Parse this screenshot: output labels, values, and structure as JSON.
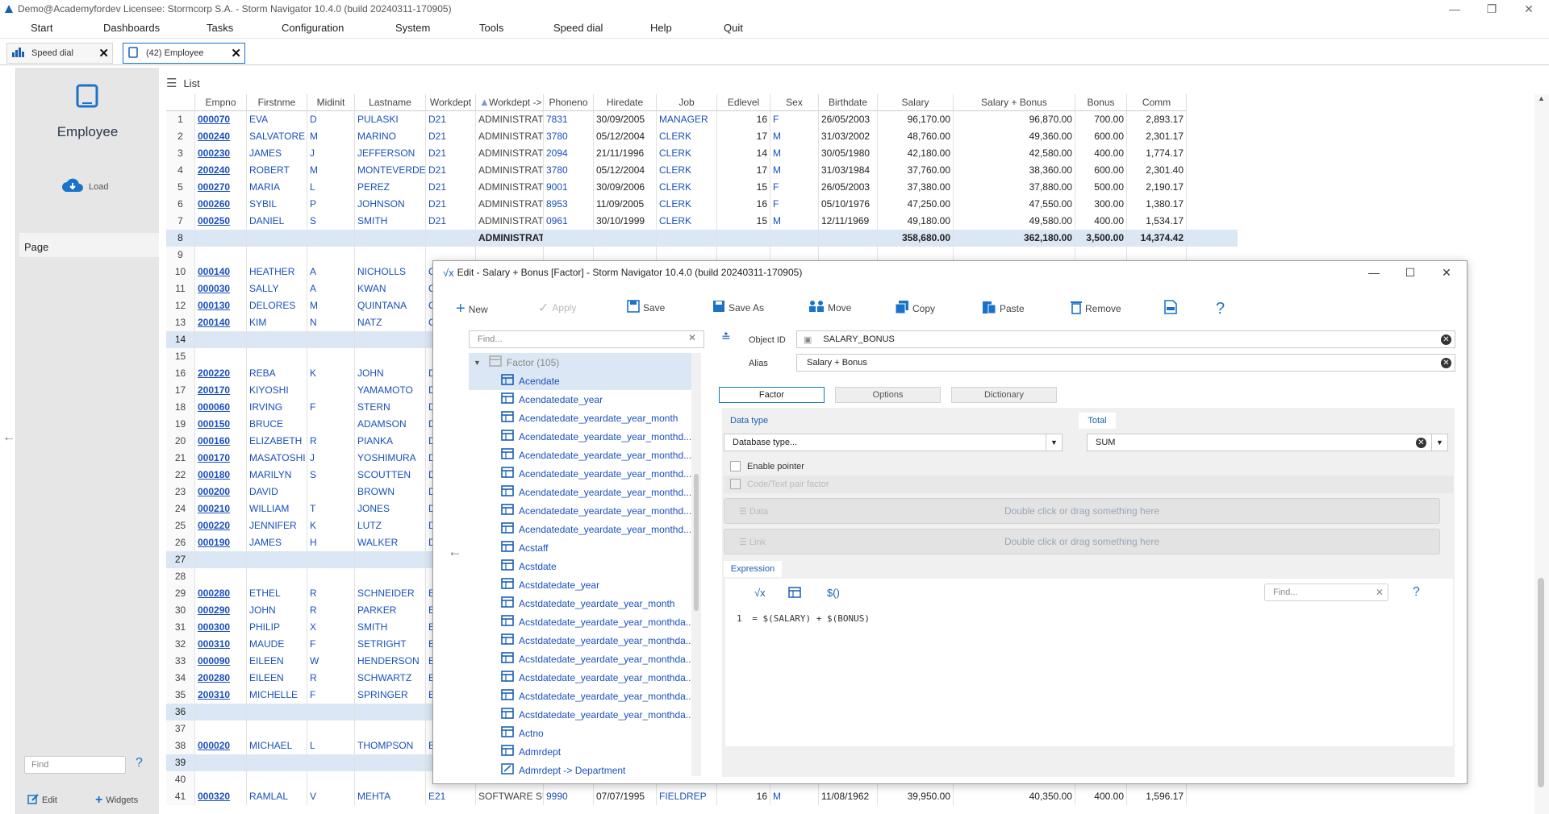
{
  "window": {
    "title": "Demo@Academyfordev    Licensee: Stormcorp S.A. - Storm Navigator 10.4.0 (build 20240311-170905)"
  },
  "menu": [
    "Start",
    "Dashboards",
    "Tasks",
    "Configuration",
    "System",
    "Tools",
    "Speed dial",
    "Help",
    "Quit"
  ],
  "tabs": [
    {
      "label": "Speed dial"
    },
    {
      "label": "(42) Employee"
    }
  ],
  "sidebar": {
    "title": "Employee",
    "load_label": "Load",
    "page_label": "Page",
    "find_placeholder": "Find",
    "edit_label": "Edit",
    "widgets_label": "Widgets"
  },
  "list": {
    "label": "List"
  },
  "grid": {
    "columns": [
      "Empno",
      "Firstnme",
      "Midinit",
      "Lastname",
      "Workdept",
      "Workdept -> Department",
      "Phoneno",
      "Hiredate",
      "Job",
      "Edlevel",
      "Sex",
      "Birthdate",
      "Salary",
      "Salary + Bonus",
      "Bonus",
      "Comm"
    ],
    "rows": [
      {
        "n": "1",
        "c": [
          "000070",
          "EVA",
          "D",
          "PULASKI",
          "D21",
          "ADMINISTRATION SYSTEMS",
          "7831",
          "30/09/2005",
          "MANAGER",
          "16",
          "F",
          "26/05/2003",
          "96,170.00",
          "96,870.00",
          "700.00",
          "2,893.17"
        ]
      },
      {
        "n": "2",
        "c": [
          "000240",
          "SALVATORE",
          "M",
          "MARINO",
          "D21",
          "ADMINISTRATION SYSTEMS",
          "3780",
          "05/12/2004",
          "CLERK",
          "17",
          "M",
          "31/03/2002",
          "48,760.00",
          "49,360.00",
          "600.00",
          "2,301.17"
        ]
      },
      {
        "n": "3",
        "c": [
          "000230",
          "JAMES",
          "J",
          "JEFFERSON",
          "D21",
          "ADMINISTRATION SYSTEMS",
          "2094",
          "21/11/1996",
          "CLERK",
          "14",
          "M",
          "30/05/1980",
          "42,180.00",
          "42,580.00",
          "400.00",
          "1,774.17"
        ]
      },
      {
        "n": "4",
        "c": [
          "200240",
          "ROBERT",
          "M",
          "MONTEVERDE",
          "D21",
          "ADMINISTRATION SYSTEMS",
          "3780",
          "05/12/2004",
          "CLERK",
          "17",
          "M",
          "31/03/1984",
          "37,760.00",
          "38,360.00",
          "600.00",
          "2,301.40"
        ]
      },
      {
        "n": "5",
        "c": [
          "000270",
          "MARIA",
          "L",
          "PEREZ",
          "D21",
          "ADMINISTRATION SYSTEMS",
          "9001",
          "30/09/2006",
          "CLERK",
          "15",
          "F",
          "26/05/2003",
          "37,380.00",
          "37,880.00",
          "500.00",
          "2,190.17"
        ]
      },
      {
        "n": "6",
        "c": [
          "000260",
          "SYBIL",
          "P",
          "JOHNSON",
          "D21",
          "ADMINISTRATION SYSTEMS",
          "8953",
          "11/09/2005",
          "CLERK",
          "16",
          "F",
          "05/10/1976",
          "47,250.00",
          "47,550.00",
          "300.00",
          "1,380.17"
        ]
      },
      {
        "n": "7",
        "c": [
          "000250",
          "DANIEL",
          "S",
          "SMITH",
          "D21",
          "ADMINISTRATION SYSTEMS",
          "0961",
          "30/10/1999",
          "CLERK",
          "15",
          "M",
          "12/11/1969",
          "49,180.00",
          "49,580.00",
          "400.00",
          "1,534.17"
        ]
      },
      {
        "n": "8",
        "sub": true,
        "c": [
          "",
          "",
          "",
          "",
          "",
          "ADMINISTRATION SYSTEMS",
          "",
          "",
          "",
          "",
          "",
          "",
          "358,680.00",
          "362,180.00",
          "3,500.00",
          "14,374.42"
        ]
      },
      {
        "n": "9",
        "c": [
          "",
          "",
          "",
          "",
          "",
          "",
          "",
          "",
          "",
          "",
          "",
          "",
          "",
          "",
          "",
          ""
        ]
      },
      {
        "n": "10",
        "c": [
          "000140",
          "HEATHER",
          "A",
          "NICHOLLS",
          "C",
          "",
          "",
          "",
          "",
          "",
          "",
          "",
          "",
          "",
          "",
          ""
        ]
      },
      {
        "n": "11",
        "c": [
          "000030",
          "SALLY",
          "A",
          "KWAN",
          "C",
          "",
          "",
          "",
          "",
          "",
          "",
          "",
          "",
          "",
          "",
          ""
        ]
      },
      {
        "n": "12",
        "c": [
          "000130",
          "DELORES",
          "M",
          "QUINTANA",
          "C",
          "",
          "",
          "",
          "",
          "",
          "",
          "",
          "",
          "",
          "",
          ""
        ]
      },
      {
        "n": "13",
        "c": [
          "200140",
          "KIM",
          "N",
          "NATZ",
          "C",
          "",
          "",
          "",
          "",
          "",
          "",
          "",
          "",
          "",
          "",
          ""
        ]
      },
      {
        "n": "14",
        "sub": true,
        "c": [
          "",
          "",
          "",
          "",
          "",
          "",
          "",
          "",
          "",
          "",
          "",
          "",
          "",
          "",
          "",
          ""
        ]
      },
      {
        "n": "15",
        "c": [
          "",
          "",
          "",
          "",
          "",
          "",
          "",
          "",
          "",
          "",
          "",
          "",
          "",
          "",
          "",
          ""
        ]
      },
      {
        "n": "16",
        "c": [
          "200220",
          "REBA",
          "K",
          "JOHN",
          "D",
          "",
          "",
          "",
          "",
          "",
          "",
          "",
          "",
          "",
          "",
          ""
        ]
      },
      {
        "n": "17",
        "c": [
          "200170",
          "KIYOSHI",
          "",
          "YAMAMOTO",
          "D",
          "",
          "",
          "",
          "",
          "",
          "",
          "",
          "",
          "",
          "",
          ""
        ]
      },
      {
        "n": "18",
        "c": [
          "000060",
          "IRVING",
          "F",
          "STERN",
          "D",
          "",
          "",
          "",
          "",
          "",
          "",
          "",
          "",
          "",
          "",
          ""
        ]
      },
      {
        "n": "19",
        "c": [
          "000150",
          "BRUCE",
          "",
          "ADAMSON",
          "D",
          "",
          "",
          "",
          "",
          "",
          "",
          "",
          "",
          "",
          "",
          ""
        ]
      },
      {
        "n": "20",
        "c": [
          "000160",
          "ELIZABETH",
          "R",
          "PIANKA",
          "D",
          "",
          "",
          "",
          "",
          "",
          "",
          "",
          "",
          "",
          "",
          ""
        ]
      },
      {
        "n": "21",
        "c": [
          "000170",
          "MASATOSHI",
          "J",
          "YOSHIMURA",
          "D",
          "",
          "",
          "",
          "",
          "",
          "",
          "",
          "",
          "",
          "",
          ""
        ]
      },
      {
        "n": "22",
        "c": [
          "000180",
          "MARILYN",
          "S",
          "SCOUTTEN",
          "D",
          "",
          "",
          "",
          "",
          "",
          "",
          "",
          "",
          "",
          "",
          ""
        ]
      },
      {
        "n": "23",
        "c": [
          "000200",
          "DAVID",
          "",
          "BROWN",
          "D",
          "",
          "",
          "",
          "",
          "",
          "",
          "",
          "",
          "",
          "",
          ""
        ]
      },
      {
        "n": "24",
        "c": [
          "000210",
          "WILLIAM",
          "T",
          "JONES",
          "D",
          "",
          "",
          "",
          "",
          "",
          "",
          "",
          "",
          "",
          "",
          ""
        ]
      },
      {
        "n": "25",
        "c": [
          "000220",
          "JENNIFER",
          "K",
          "LUTZ",
          "D",
          "",
          "",
          "",
          "",
          "",
          "",
          "",
          "",
          "",
          "",
          ""
        ]
      },
      {
        "n": "26",
        "c": [
          "000190",
          "JAMES",
          "H",
          "WALKER",
          "D",
          "",
          "",
          "",
          "",
          "",
          "",
          "",
          "",
          "",
          "",
          ""
        ]
      },
      {
        "n": "27",
        "sub": true,
        "c": [
          "",
          "",
          "",
          "",
          "",
          "",
          "",
          "",
          "",
          "",
          "",
          "",
          "",
          "",
          "",
          ""
        ]
      },
      {
        "n": "28",
        "c": [
          "",
          "",
          "",
          "",
          "",
          "",
          "",
          "",
          "",
          "",
          "",
          "",
          "",
          "",
          "",
          ""
        ]
      },
      {
        "n": "29",
        "c": [
          "000280",
          "ETHEL",
          "R",
          "SCHNEIDER",
          "E",
          "",
          "",
          "",
          "",
          "",
          "",
          "",
          "",
          "",
          "",
          ""
        ]
      },
      {
        "n": "30",
        "c": [
          "000290",
          "JOHN",
          "R",
          "PARKER",
          "E",
          "",
          "",
          "",
          "",
          "",
          "",
          "",
          "",
          "",
          "",
          ""
        ]
      },
      {
        "n": "31",
        "c": [
          "000300",
          "PHILIP",
          "X",
          "SMITH",
          "E",
          "",
          "",
          "",
          "",
          "",
          "",
          "",
          "",
          "",
          "",
          ""
        ]
      },
      {
        "n": "32",
        "c": [
          "000310",
          "MAUDE",
          "F",
          "SETRIGHT",
          "E",
          "",
          "",
          "",
          "",
          "",
          "",
          "",
          "",
          "",
          "",
          ""
        ]
      },
      {
        "n": "33",
        "c": [
          "000090",
          "EILEEN",
          "W",
          "HENDERSON",
          "E",
          "",
          "",
          "",
          "",
          "",
          "",
          "",
          "",
          "",
          "",
          ""
        ]
      },
      {
        "n": "34",
        "c": [
          "200280",
          "EILEEN",
          "R",
          "SCHWARTZ",
          "E",
          "",
          "",
          "",
          "",
          "",
          "",
          "",
          "",
          "",
          "",
          ""
        ]
      },
      {
        "n": "35",
        "c": [
          "200310",
          "MICHELLE",
          "F",
          "SPRINGER",
          "E",
          "",
          "",
          "",
          "",
          "",
          "",
          "",
          "",
          "",
          "",
          ""
        ]
      },
      {
        "n": "36",
        "sub": true,
        "c": [
          "",
          "",
          "",
          "",
          "",
          "",
          "",
          "",
          "",
          "",
          "",
          "",
          "",
          "",
          "",
          ""
        ]
      },
      {
        "n": "37",
        "c": [
          "",
          "",
          "",
          "",
          "",
          "",
          "",
          "",
          "",
          "",
          "",
          "",
          "",
          "",
          "",
          ""
        ]
      },
      {
        "n": "38",
        "c": [
          "000020",
          "MICHAEL",
          "L",
          "THOMPSON",
          "B",
          "",
          "",
          "",
          "",
          "",
          "",
          "",
          "",
          "",
          "",
          ""
        ]
      },
      {
        "n": "39",
        "sub": true,
        "c": [
          "",
          "",
          "",
          "",
          "",
          "",
          "",
          "",
          "",
          "",
          "",
          "",
          "",
          "",
          "",
          ""
        ]
      },
      {
        "n": "40",
        "c": [
          "",
          "",
          "",
          "",
          "",
          "",
          "",
          "",
          "",
          "",
          "",
          "",
          "",
          "",
          "",
          ""
        ]
      },
      {
        "n": "41",
        "c": [
          "000320",
          "RAMLAL",
          "V",
          "MEHTA",
          "E21",
          "SOFTWARE SUPPORT",
          "9990",
          "07/07/1995",
          "FIELDREP",
          "16",
          "M",
          "11/08/1962",
          "39,950.00",
          "40,350.00",
          "400.00",
          "1,596.17"
        ]
      }
    ]
  },
  "dialog": {
    "title": "Edit - Salary + Bonus [Factor] -  Storm Navigator 10.4.0 (build 20240311-170905)",
    "toolbar": {
      "new": "New",
      "apply": "Apply",
      "save": "Save",
      "save_as": "Save As",
      "move": "Move",
      "copy": "Copy",
      "paste": "Paste",
      "remove": "Remove"
    },
    "find_placeholder": "Find...",
    "tree_root": "Factor (105)",
    "tree": [
      "Acendate",
      "Acendatedate_year",
      "Acendatedate_yeardate_year_month",
      "Acendatedate_yeardate_year_monthd...",
      "Acendatedate_yeardate_year_monthd...",
      "Acendatedate_yeardate_year_monthd...",
      "Acendatedate_yeardate_year_monthd...",
      "Acendatedate_yeardate_year_monthd...",
      "Acendatedate_yeardate_year_monthd...",
      "Acstaff",
      "Acstdate",
      "Acstdatedate_year",
      "Acstdatedate_yeardate_year_month",
      "Acstdatedate_yeardate_year_monthda...",
      "Acstdatedate_yeardate_year_monthda...",
      "Acstdatedate_yeardate_year_monthda...",
      "Acstdatedate_yeardate_year_monthda...",
      "Acstdatedate_yeardate_year_monthda...",
      "Acstdatedate_yeardate_year_monthda...",
      "Actno",
      "Admrdept",
      "Admrdept -> Department"
    ],
    "object_id_label": "Object ID",
    "object_id": "SALARY_BONUS",
    "alias_label": "Alias",
    "alias": "Salary + Bonus",
    "tabs": [
      "Factor",
      "Options",
      "Dictionary"
    ],
    "data_type_label": "Data type",
    "data_type": "Database type...",
    "total_label": "Total",
    "total": "SUM",
    "enable_pointer": "Enable pointer",
    "code_text_pair": "Code/Text pair factor",
    "data_label": "Data",
    "link_label": "Link",
    "drop_hint": "Double click or drag something here",
    "expression_label": "Expression",
    "expr_find_placeholder": "Find...",
    "expression_line_no": "1",
    "expression": "= $(SALARY) + $(BONUS)"
  }
}
